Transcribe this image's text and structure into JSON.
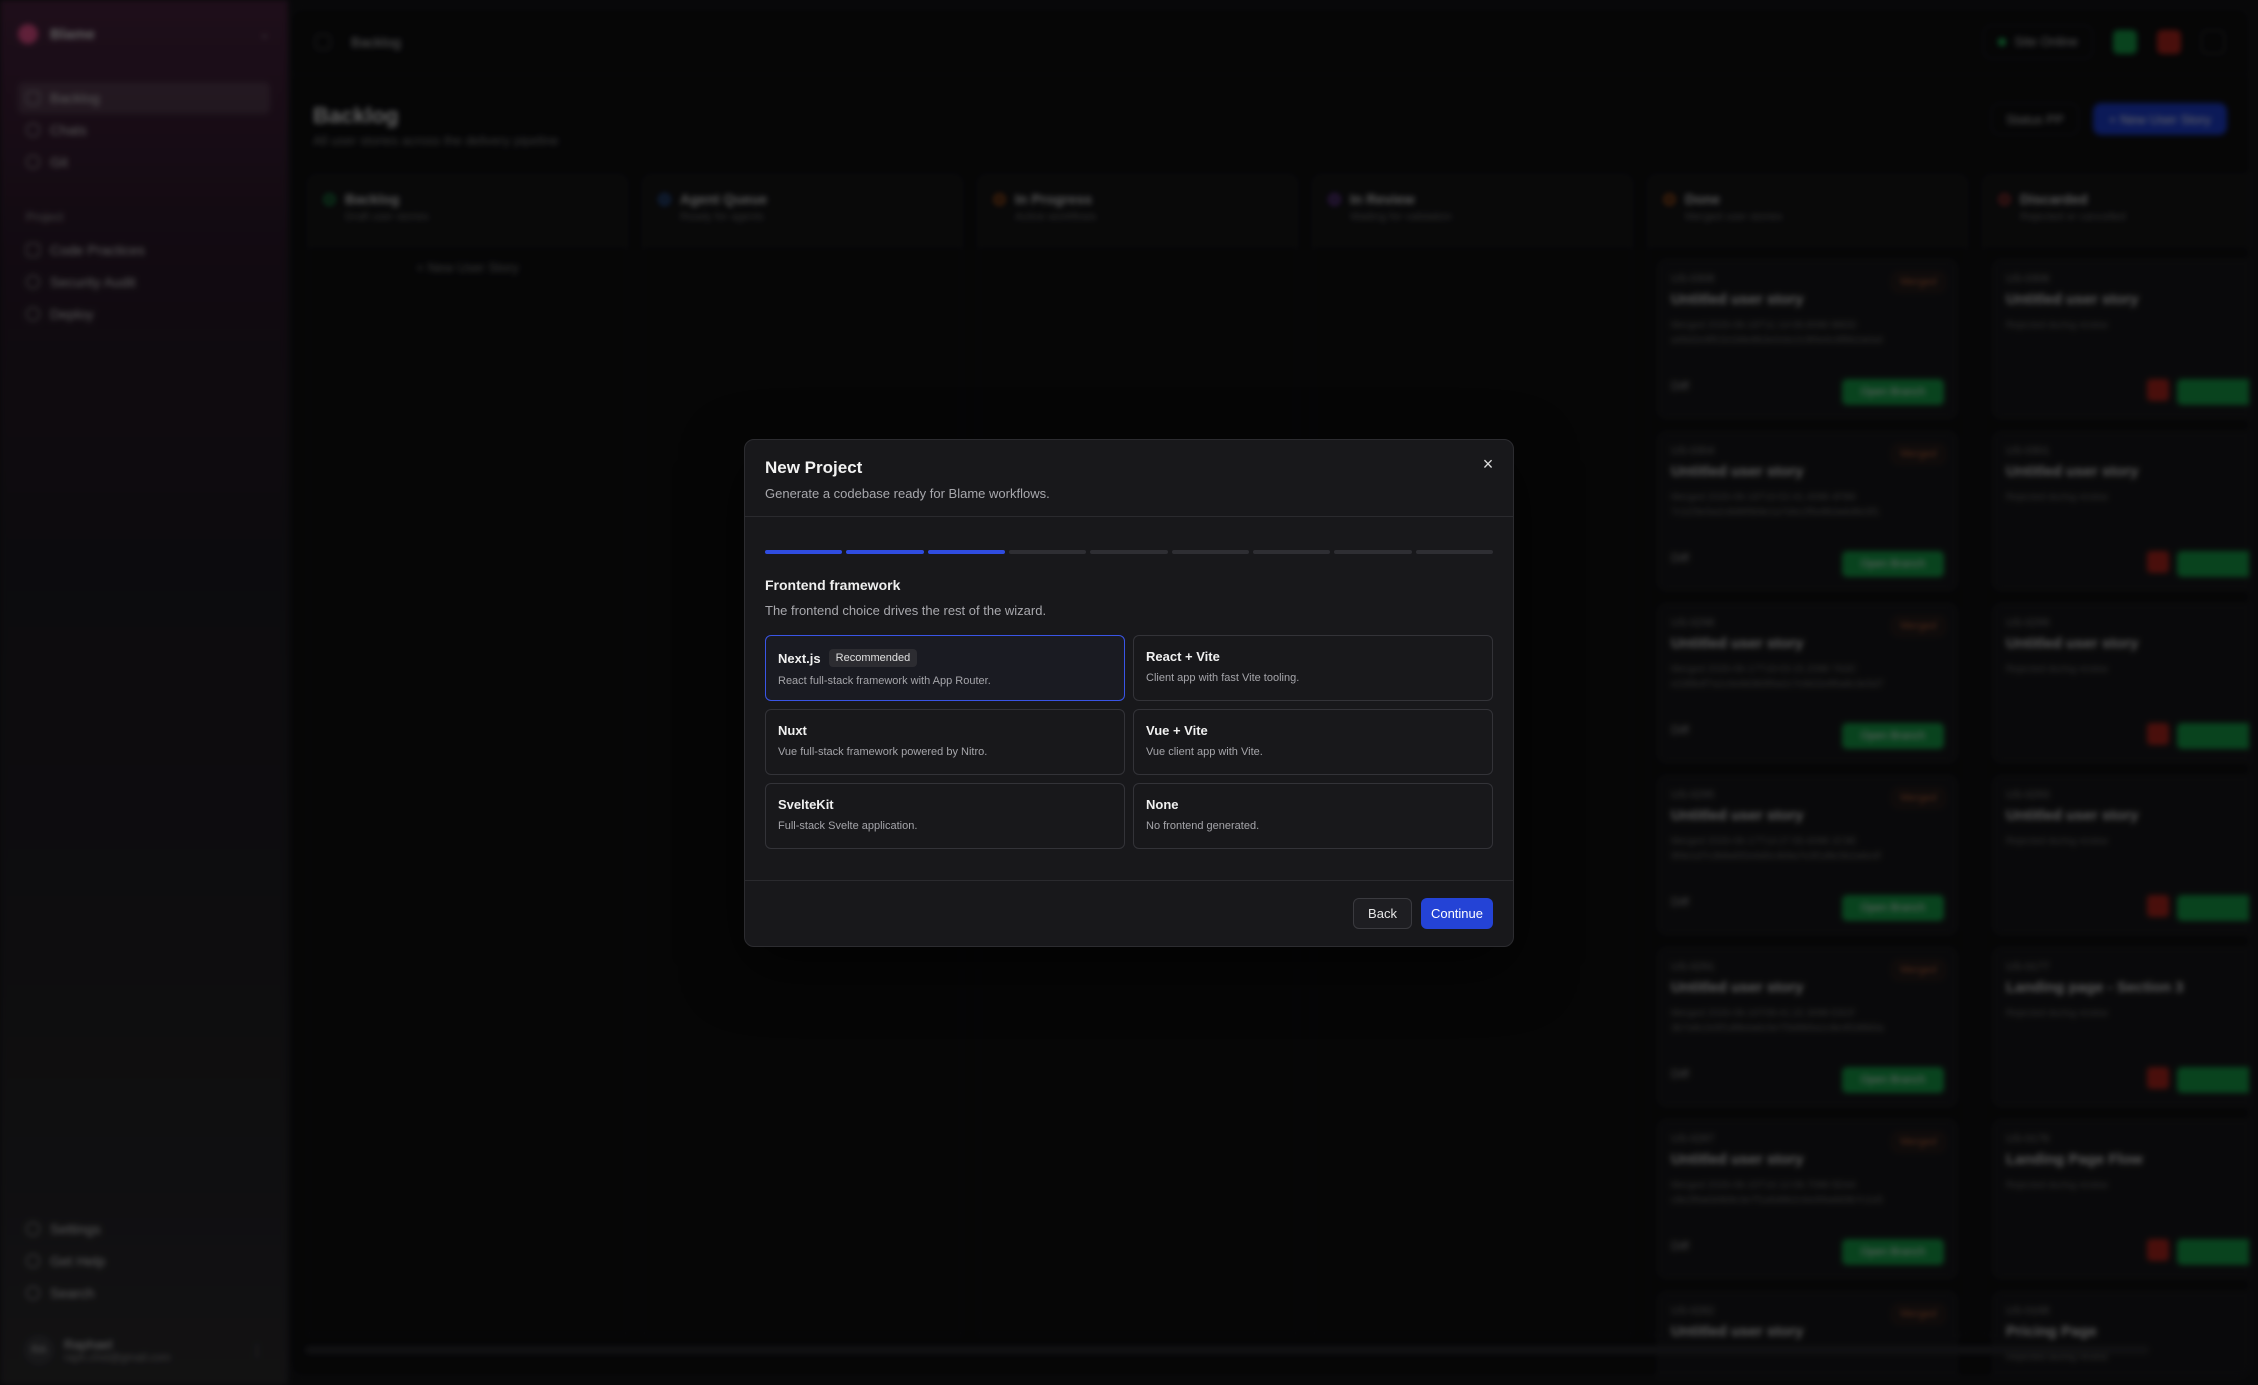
{
  "sidebar": {
    "workspace": "Blame",
    "nav": [
      {
        "label": "Backlog"
      },
      {
        "label": "Chats"
      },
      {
        "label": "Git"
      }
    ],
    "section_label": "Project",
    "project_nav": [
      {
        "label": "Code Practices"
      },
      {
        "label": "Security Audit"
      },
      {
        "label": "Deploy"
      }
    ],
    "bottom_nav": [
      {
        "label": "Settings"
      },
      {
        "label": "Get Help"
      },
      {
        "label": "Search"
      }
    ],
    "user": {
      "initials": "RA",
      "name": "Raphael",
      "email": "raph.chst@gmail.com"
    }
  },
  "topbar": {
    "breadcrumb": "Backlog",
    "env": "Site Online"
  },
  "page": {
    "title": "Backlog",
    "subtitle": "All user stories across the delivery pipeline",
    "ghost_button": "Status PP",
    "primary_button": "+ New User Story"
  },
  "board": {
    "columns": [
      {
        "title": "Backlog",
        "sub": "Draft user stories",
        "color": "#22c55e",
        "new_story": "+ New User Story"
      },
      {
        "title": "Agent Queue",
        "sub": "Ready for agents",
        "color": "#3b82f6"
      },
      {
        "title": "In Progress",
        "sub": "Active workflows",
        "color": "#f97316"
      },
      {
        "title": "In Review",
        "sub": "Waiting for validation",
        "color": "#a855f7"
      },
      {
        "title": "Done",
        "sub": "Merged user stories",
        "color": "#f97316"
      },
      {
        "title": "Discarded",
        "sub": "Rejected or cancelled",
        "color": "#ef4444"
      }
    ],
    "done_cards": [
      {
        "id": "US-0308",
        "title": "Untitled user story",
        "tag": "Merged",
        "meta": "Merged 2026-06-18T11:14:08.8098 98DD a46d2e9f51b1b8e8b3e0cbc2c9f4e6c8f8b2a0a4",
        "diff": "Diff",
        "action": "Open Branch"
      },
      {
        "id": "US-0304",
        "title": "Untitled user story",
        "tag": "Merged",
        "meta": "Merged 2026-06-18T10:52:41.4098 4FB8 7c11f3e5a2c8d6f0b9e1a7d4c2f5e8b3a6d9c0f1",
        "diff": "Diff",
        "action": "Open Branch"
      },
      {
        "id": "US-0298",
        "title": "Untitled user story",
        "tag": "Merged",
        "meta": "Merged 2026-06-17T18:03:15.2098 7A3C e2d9b4f7a1c6e8d3b5f0a2c7e9d1b4f6a8c3e5d7",
        "diff": "Diff",
        "action": "Open Branch"
      },
      {
        "id": "US-0295",
        "title": "Untitled user story",
        "tag": "Merged",
        "meta": "Merged 2026-06-17T14:27:55.6098 2C9E 9f4e1d7c3b8a5f2e6d0c4b9a7e3f1d8c5b2a6e4f",
        "diff": "Diff",
        "action": "Open Branch"
      },
      {
        "id": "US-0291",
        "title": "Untitled user story",
        "tag": "Merged",
        "meta": "Merged 2026-06-16T09:41:22.3098 E81F 3b7a9c2e5f1d8b4a6c0e7f3d9b5a1c8e4f2d6b0a",
        "diff": "Diff",
        "action": "Open Branch"
      },
      {
        "id": "US-0287",
        "title": "Untitled user story",
        "tag": "Merged",
        "meta": "Merged 2026-06-15T16:12:09.7098 5D44 c8e2f6a0d4b9c3e7f1a5d8b2c6e0f4a9d3b7c1e5",
        "diff": "Diff",
        "action": "Open Branch"
      },
      {
        "id": "US-0282",
        "title": "Untitled user story",
        "tag": "Merged",
        "meta": "",
        "diff": "",
        "action": ""
      }
    ],
    "discarded_cards": [
      {
        "id": "US-0306",
        "title": "Untitled user story",
        "meta": "Rejected during review"
      },
      {
        "id": "US-0301",
        "title": "Untitled user story",
        "meta": "Rejected during review"
      },
      {
        "id": "US-0299",
        "title": "Untitled user story",
        "meta": "Rejected during review"
      },
      {
        "id": "US-0293",
        "title": "Untitled user story",
        "meta": "Rejected during review"
      },
      {
        "id": "US-0177",
        "title": "Landing page - Section 3",
        "meta": "Rejected during review"
      },
      {
        "id": "US-0176",
        "title": "Landing Page Flow",
        "meta": "Rejected during review"
      },
      {
        "id": "US-0168",
        "title": "Pricing Page",
        "meta": "Rejected during review"
      }
    ]
  },
  "dialog": {
    "title": "New Project",
    "description": "Generate a codebase ready for Blame workflows.",
    "steps_total": 9,
    "steps_done": 3,
    "section_title": "Frontend framework",
    "section_desc": "The frontend choice drives the rest of the wizard.",
    "options": [
      {
        "name": "Next.js",
        "badge": "Recommended",
        "desc": "React full-stack framework with App Router.",
        "selected": true
      },
      {
        "name": "React + Vite",
        "badge": "",
        "desc": "Client app with fast Vite tooling.",
        "selected": false
      },
      {
        "name": "Nuxt",
        "badge": "",
        "desc": "Vue full-stack framework powered by Nitro.",
        "selected": false
      },
      {
        "name": "Vue + Vite",
        "badge": "",
        "desc": "Vue client app with Vite.",
        "selected": false
      },
      {
        "name": "SvelteKit",
        "badge": "",
        "desc": "Full-stack Svelte application.",
        "selected": false
      },
      {
        "name": "None",
        "badge": "",
        "desc": "No frontend generated.",
        "selected": false
      }
    ],
    "back_label": "Back",
    "continue_label": "Continue",
    "close_icon": "×"
  },
  "colors": {
    "accent": "#2443d6",
    "progress": "#2f4ce0",
    "selected_border": "#3a55e6"
  }
}
